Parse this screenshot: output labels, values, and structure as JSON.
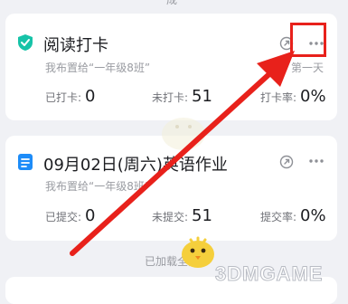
{
  "top_fragment": "成",
  "cards": [
    {
      "title": "阅读打卡",
      "subtitle": "我布置给“一年级8班”",
      "stats": [
        {
          "label": "已打卡:",
          "value": "0"
        },
        {
          "label": "未打卡:",
          "value": "51"
        },
        {
          "label": "打卡率:",
          "value": "0%"
        }
      ],
      "icon": "shield-check-icon",
      "partial_text": "第一天"
    },
    {
      "title": "09月02日(周六)英语作业",
      "subtitle": "我布置给“一年级8班”",
      "stats": [
        {
          "label": "已提交:",
          "value": "0"
        },
        {
          "label": "未提交:",
          "value": "51"
        },
        {
          "label": "提交率:",
          "value": "0%"
        }
      ],
      "icon": "document-icon"
    }
  ],
  "footer_text": "已加载全部",
  "watermark": "3DMGAME",
  "colors": {
    "accent_green": "#17c3a8",
    "accent_blue": "#1d8cf8",
    "highlight_red": "#e8211b"
  }
}
